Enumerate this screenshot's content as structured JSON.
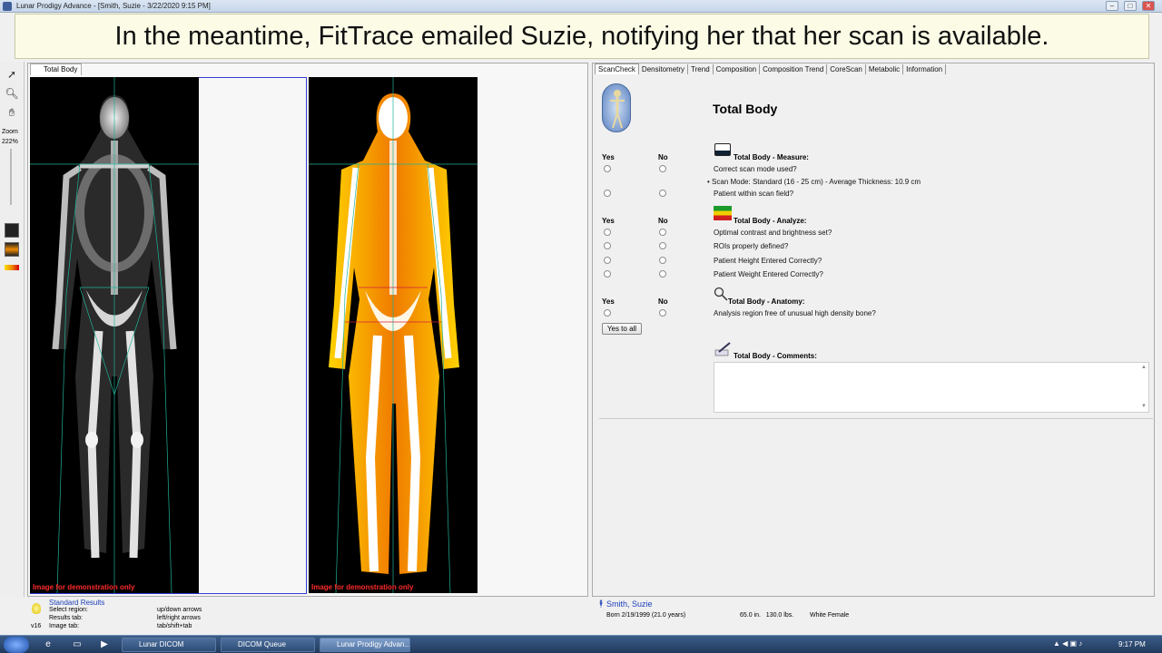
{
  "window": {
    "title": "Lunar Prodigy Advance - [Smith, Suzie - 3/22/2020 9:15 PM]",
    "controls": {
      "minimize": "–",
      "maximize": "□",
      "close": "✕"
    }
  },
  "caption": "In the meantime, FitTrace emailed Suzie, notifying her that her scan is available.",
  "left_toolbar": {
    "zoom_label": "Zoom",
    "zoom_value": "222%",
    "icons": [
      "pointer-icon",
      "magnifier-icon",
      "hand-icon",
      "skeleton-view-icon",
      "color-view-icon",
      "color-bar-icon"
    ]
  },
  "image_panel": {
    "tab_label": "Total Body",
    "watermark_left": "Image for demonstration only",
    "watermark_right": "Image for demonstration only"
  },
  "tabs": [
    "ScanCheck",
    "Densitometry",
    "Trend",
    "Composition",
    "Composition Trend",
    "CoreScan",
    "Metabolic",
    "Information"
  ],
  "active_tab": "ScanCheck",
  "scancheck": {
    "title": "Total Body",
    "yes_label": "Yes",
    "no_label": "No",
    "measure": {
      "title": "Total Body - Measure:",
      "q1": "Correct scan mode used?",
      "scan_mode": "Scan Mode: Standard (16 - 25 cm) - Average Thickness: 10.9 cm",
      "q2": "Patient within scan field?"
    },
    "analyze": {
      "title": "Total Body - Analyze:",
      "q1": "Optimal contrast and brightness set?",
      "q2": "ROIs properly defined?",
      "q3": "Patient Height Entered Correctly?",
      "q4": "Patient Weight Entered Correctly?"
    },
    "anatomy": {
      "title": "Total Body - Anatomy:",
      "q1": "Analysis region free of unusual high density bone?"
    },
    "yes_to_all": "Yes to all",
    "comments_title": "Total Body - Comments:",
    "comments_value": ""
  },
  "status_left": {
    "title": "Standard Results",
    "version": "v16",
    "rows": [
      {
        "label": "Select region:",
        "value": "up/down arrows"
      },
      {
        "label": "Results tab:",
        "value": "left/right arrows"
      },
      {
        "label": "Image tab:",
        "value": "tab/shift+tab"
      }
    ]
  },
  "status_right": {
    "patient_name": "Smith, Suzie",
    "born": "Born 2/19/1999 (21.0 years)",
    "height_weight": "65.0 in.   130.0 lbs.",
    "sex_ethnicity": "White Female"
  },
  "taskbar": {
    "buttons": [
      "Lunar DICOM",
      "DICOM Queue",
      "Lunar Prodigy Advan..."
    ],
    "active_button": "Lunar Prodigy Advan...",
    "clock": "9:17 PM"
  },
  "colors": {
    "caption_bg": "#fbfbe6",
    "frame_blue": "#2f3fd0",
    "watermark_red": "#ff2a2a",
    "patient_blue": "#1c3fb8",
    "fat_orange": "#f08a00"
  }
}
